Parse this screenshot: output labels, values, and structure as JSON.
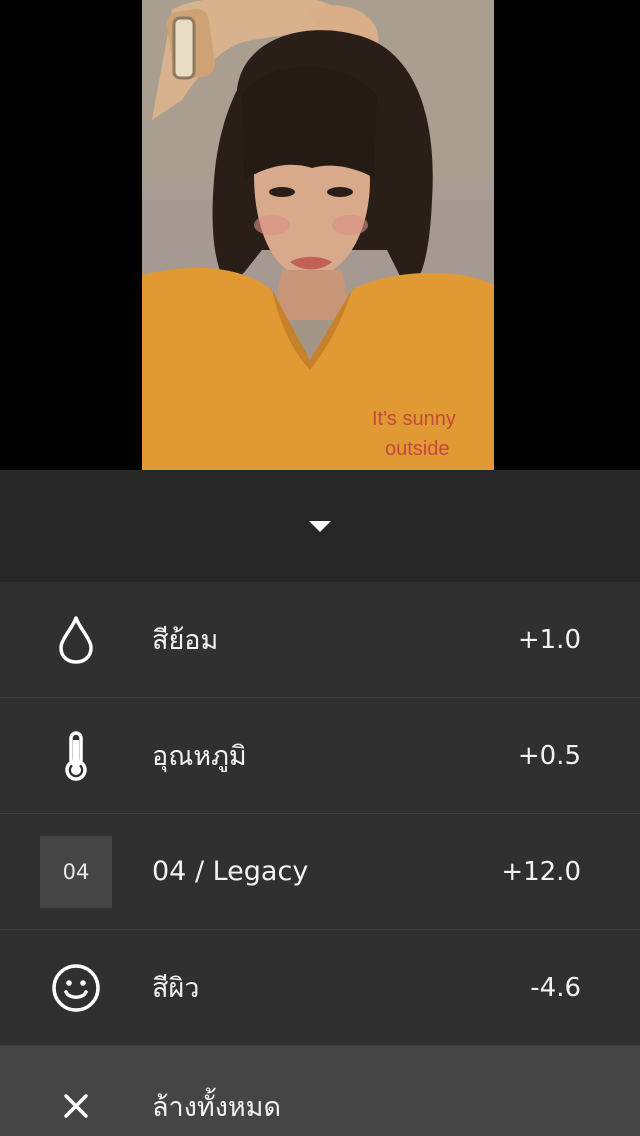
{
  "photo": {
    "shirt_text_line1": "It's sunny",
    "shirt_text_line2": "outside"
  },
  "panel": {
    "collapse_icon": "chevron-down-icon",
    "items": [
      {
        "icon": "droplet-icon",
        "label": "สีย้อม",
        "value": "+1.0"
      },
      {
        "icon": "thermometer-icon",
        "label": "อุณหภูมิ",
        "value": "+0.5"
      },
      {
        "icon_text": "04",
        "label": "04 / Legacy",
        "value": "+12.0"
      },
      {
        "icon": "smiley-face-icon",
        "label": "สีผิว",
        "value": "-4.6"
      }
    ],
    "clear_all": {
      "icon": "close-icon",
      "label": "ล้างทั้งหมด"
    }
  },
  "colors": {
    "panel_bg": "#303030",
    "header_bg": "#262626",
    "clear_bg": "#454545",
    "text": "#f2f2f2"
  }
}
